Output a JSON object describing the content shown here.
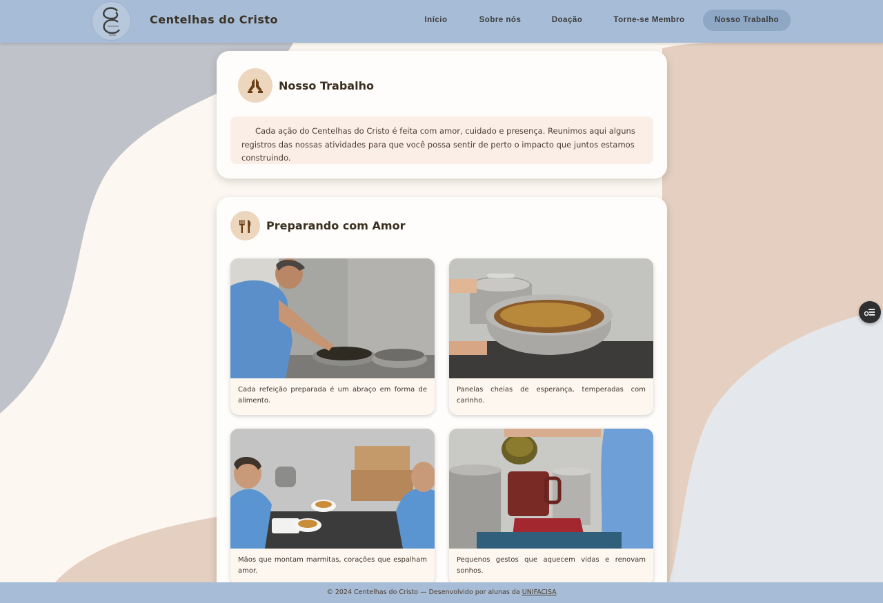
{
  "header": {
    "brand": "Centelhas do Cristo",
    "nav": [
      {
        "label": "Início",
        "active": false
      },
      {
        "label": "Sobre nós",
        "active": false
      },
      {
        "label": "Doação",
        "active": false
      },
      {
        "label": "Torne-se Membro",
        "active": false
      },
      {
        "label": "Nosso Trabalho",
        "active": true
      }
    ]
  },
  "intro": {
    "title": "Nosso Trabalho",
    "icon": "praying-hands-icon",
    "text": "Cada ação do Centelhas do Cristo é feita com amor, cuidado e presença. Reunimos aqui alguns registros das nossas atividades para que você possa sentir de perto o impacto que juntos estamos construindo."
  },
  "gallery": {
    "title": "Preparando com Amor",
    "icon": "utensils-icon",
    "items": [
      {
        "caption": "Cada refeição preparada é um abraço em forma de alimento."
      },
      {
        "caption": "Panelas cheias de esperança, temperadas com carinho."
      },
      {
        "caption": "Mãos que montam marmitas, corações que espalham amor."
      },
      {
        "caption": "Pequenos gestos que aquecem vidas e renovam sonhos."
      }
    ]
  },
  "footer": {
    "text": "© 2024 Centelhas do Cristo — Desenvolvido por alunas da ",
    "link": "UNIFACISA"
  },
  "colors": {
    "navbar": "#a7bcd6",
    "nav_active": "#8ea7c4",
    "icon_bg": "#ecd7be",
    "intro_bg": "#fbeee6"
  }
}
